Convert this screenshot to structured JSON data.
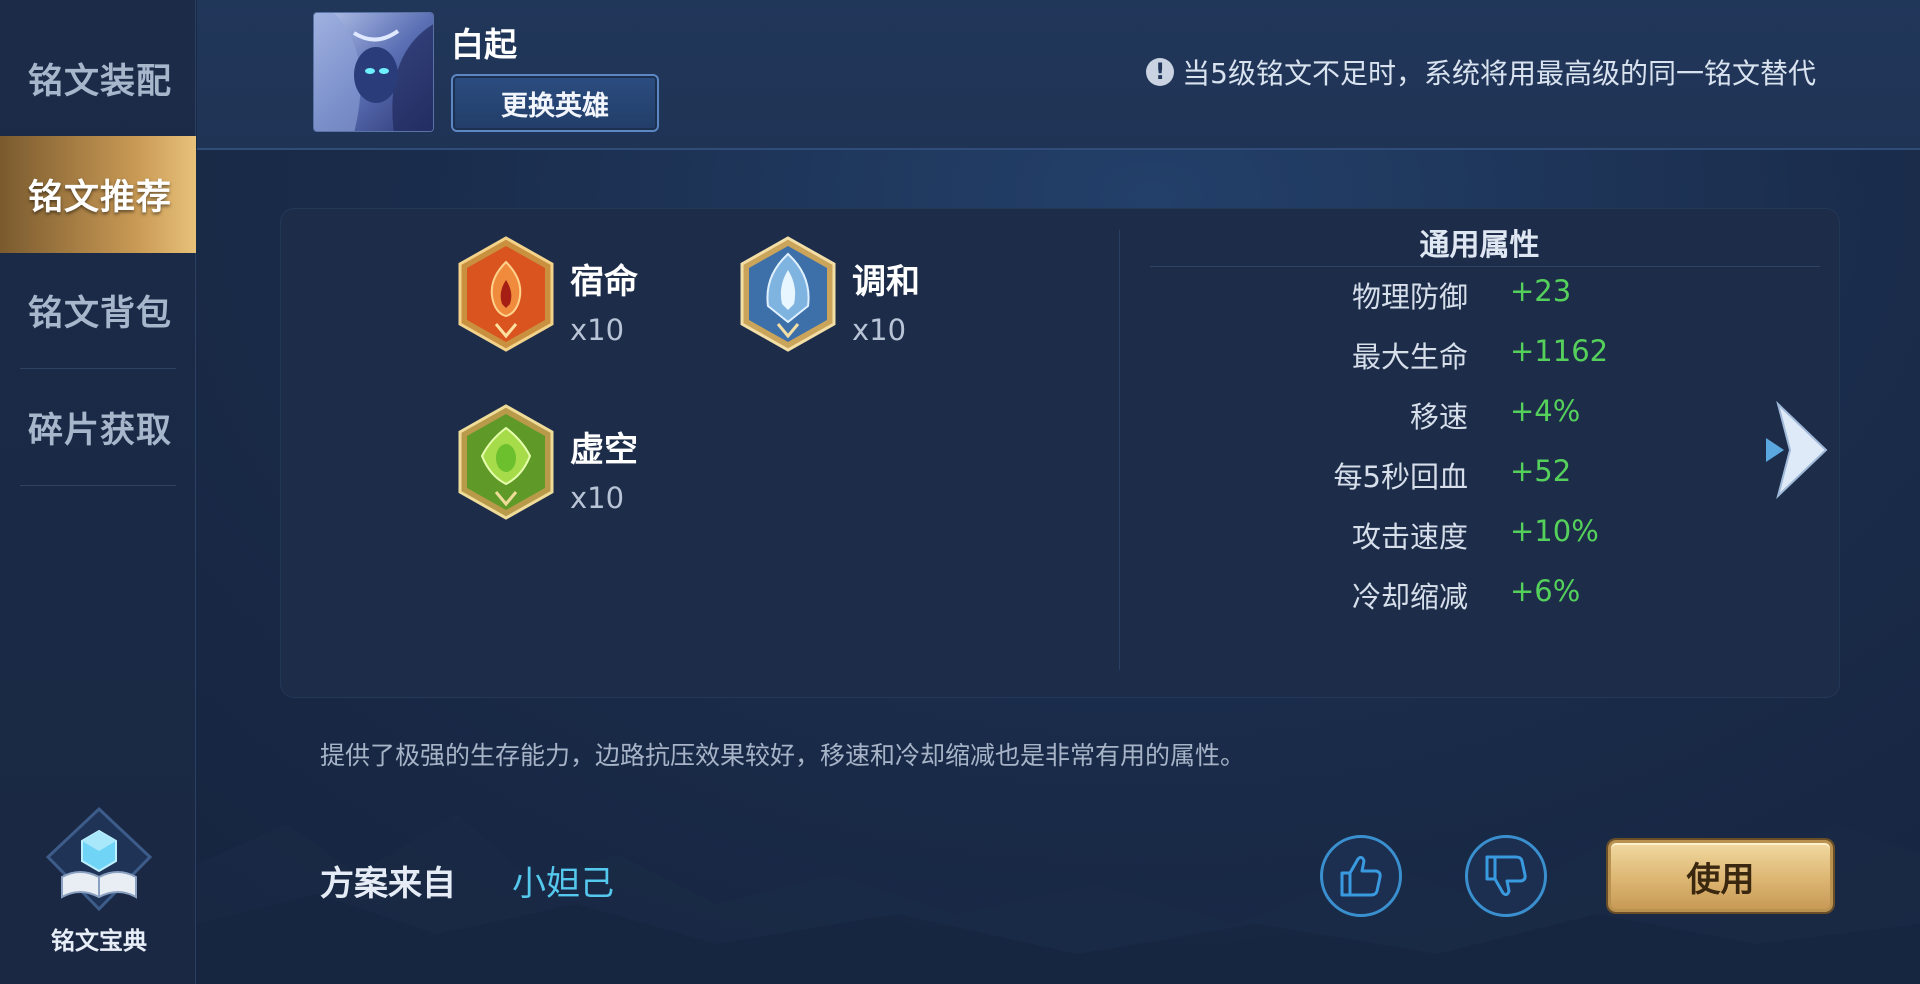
{
  "sidebar": {
    "items": [
      {
        "label": "铭文装配",
        "active": false
      },
      {
        "label": "铭文推荐",
        "active": true
      },
      {
        "label": "铭文背包",
        "active": false
      },
      {
        "label": "碎片获取",
        "active": false
      }
    ],
    "codex_label": "铭文宝典"
  },
  "header": {
    "hero_name": "白起",
    "swap_button": "更换英雄",
    "notice": "当5级铭文不足时，系统将用最高级的同一铭文替代"
  },
  "runes": [
    {
      "name": "宿命",
      "count": "x10",
      "color": "#d9541e"
    },
    {
      "name": "调和",
      "count": "x10",
      "color": "#4f86c4"
    },
    {
      "name": "虚空",
      "count": "x10",
      "color": "#6fb12c"
    }
  ],
  "attributes": {
    "title": "通用属性",
    "rows": [
      {
        "name": "物理防御",
        "value": "+23"
      },
      {
        "name": "最大生命",
        "value": "+1162"
      },
      {
        "name": "移速",
        "value": "+4%"
      },
      {
        "name": "每5秒回血",
        "value": "+52"
      },
      {
        "name": "攻击速度",
        "value": "+10%"
      },
      {
        "name": "冷却缩减",
        "value": "+6%"
      }
    ]
  },
  "description": "提供了极强的生存能力，边路抗压效果较好，移速和冷却缩减也是非常有用的属性。",
  "source": {
    "label": "方案来自",
    "user": "小妲己"
  },
  "actions": {
    "use_button": "使用"
  },
  "colors": {
    "accent_gold": "#c99a55",
    "attr_value_green": "#55d15b",
    "link_cyan": "#55c8ee"
  }
}
